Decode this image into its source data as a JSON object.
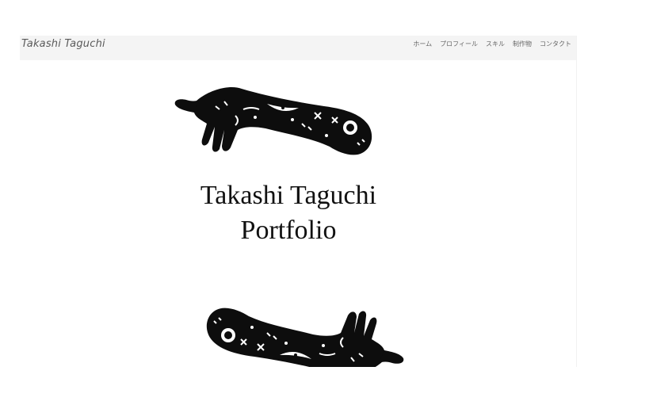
{
  "header": {
    "brand": "Takashi Taguchi",
    "nav": [
      "ホーム",
      "プロフィール",
      "スキル",
      "制作物",
      "コンタクト"
    ]
  },
  "hero": {
    "line1": "Takashi Taguchi",
    "line2": "Portfolio",
    "top_illustration": "hand-illustration-top",
    "bottom_illustration": "hand-illustration-bottom"
  },
  "colors": {
    "navbar_bg": "#f4f4f4",
    "text": "#111111",
    "nav_text": "#666666"
  }
}
